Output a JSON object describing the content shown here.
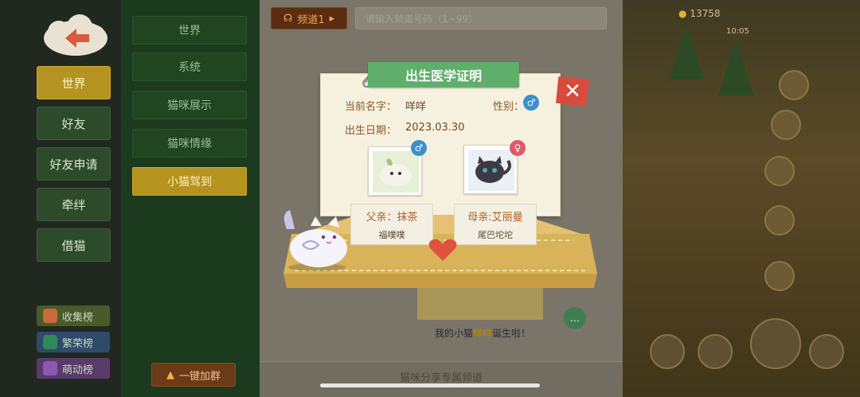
{
  "left_menu": {
    "items": [
      {
        "label": "世界",
        "active": true
      },
      {
        "label": "好友",
        "active": false
      },
      {
        "label": "好友申请",
        "active": false
      },
      {
        "label": "牵绊",
        "active": false
      },
      {
        "label": "借猫",
        "active": false
      }
    ],
    "rankings": [
      {
        "label": "收集榜",
        "icon": "collection-icon",
        "color": "#c96a3a"
      },
      {
        "label": "繁荣榜",
        "icon": "prosperity-icon",
        "color": "#2f8a5a"
      },
      {
        "label": "萌动榜",
        "icon": "trophy-icon",
        "color": "#8a5ab0"
      }
    ]
  },
  "sub_menu": {
    "items": [
      {
        "label": "世界",
        "active": false
      },
      {
        "label": "系统",
        "active": false
      },
      {
        "label": "猫咪展示",
        "active": false
      },
      {
        "label": "猫咪情缘",
        "active": false
      },
      {
        "label": "小猫驾到",
        "active": true
      }
    ],
    "join_button": "一键加群"
  },
  "chat": {
    "channel_button": "频道1",
    "channel_input_placeholder": "请输入频道号码（1~99）",
    "caption_prefix": "我的小猫",
    "caption_name": "咩咩",
    "caption_suffix": "诞生啦！",
    "footer": "猫咪分享专属频道"
  },
  "status": {
    "coins": "13758",
    "time": "10:05"
  },
  "certificate": {
    "title": "出生医学证明",
    "name_label": "当前名字：",
    "name_value": "咩咩",
    "gender_label": "性别：",
    "gender_symbol": "♂",
    "birth_label": "出生日期：",
    "birth_value": "2023.03.30",
    "father": {
      "role": "父亲：抹茶",
      "name": "福噗噗",
      "symbol": "♂"
    },
    "mother": {
      "role": "母亲:艾丽曼",
      "name": "尾巴坨坨",
      "symbol": "♀"
    }
  },
  "colors": {
    "male": "#3d8fc9",
    "female": "#e0586a",
    "tab_green": "#5fae6a",
    "close_red": "#d84a3a"
  }
}
